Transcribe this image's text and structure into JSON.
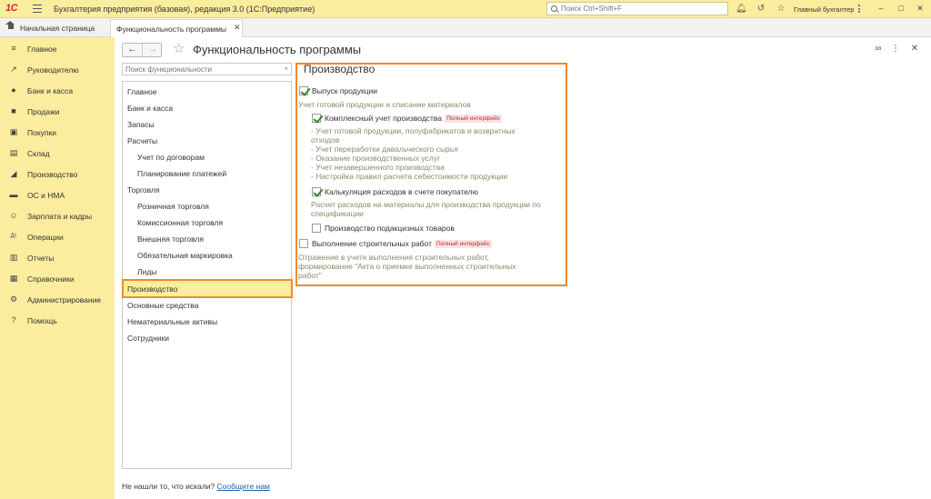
{
  "titlebar": {
    "logo": "1С",
    "app_title": "Бухгалтерия предприятия (базовая), редакция 3.0  (1С:Предприятие)",
    "search_placeholder": "Поиск Ctrl+Shift+F",
    "user": "Главный бухгалтер"
  },
  "tabs": {
    "home": "Начальная страница",
    "open": "Функциональность программы"
  },
  "sidebar": {
    "items": [
      {
        "label": "Главное",
        "icon": "menu-lines-icon"
      },
      {
        "label": "Руководителю",
        "icon": "trend-icon"
      },
      {
        "label": "Банк и касса",
        "icon": "coins-icon"
      },
      {
        "label": "Продажи",
        "icon": "bag-icon"
      },
      {
        "label": "Покупки",
        "icon": "cart-icon"
      },
      {
        "label": "Склад",
        "icon": "box-icon"
      },
      {
        "label": "Производство",
        "icon": "factory-icon"
      },
      {
        "label": "ОС и НМА",
        "icon": "truck-icon"
      },
      {
        "label": "Зарплата и кадры",
        "icon": "people-icon"
      },
      {
        "label": "Операции",
        "icon": "dt-kt-icon"
      },
      {
        "label": "Отчеты",
        "icon": "chart-icon"
      },
      {
        "label": "Справочники",
        "icon": "book-icon"
      },
      {
        "label": "Администрирование",
        "icon": "gear-icon"
      },
      {
        "label": "Помощь",
        "icon": "question-icon"
      }
    ]
  },
  "form": {
    "title": "Функциональность программы",
    "search_placeholder": "Поиск функциональности",
    "tree": [
      {
        "label": "Главное",
        "level": 0
      },
      {
        "label": "Банк и касса",
        "level": 0
      },
      {
        "label": "Запасы",
        "level": 0
      },
      {
        "label": "Расчеты",
        "level": 0
      },
      {
        "label": "Учет по договорам",
        "level": 1
      },
      {
        "label": "Планирование платежей",
        "level": 1
      },
      {
        "label": "Торговля",
        "level": 0
      },
      {
        "label": "Розничная торговля",
        "level": 1
      },
      {
        "label": "Комиссионная торговля",
        "level": 1
      },
      {
        "label": "Внешняя торговля",
        "level": 1
      },
      {
        "label": "Обязательная маркировка",
        "level": 1
      },
      {
        "label": "Лиды",
        "level": 1
      },
      {
        "label": "Производство",
        "level": 0,
        "selected": true
      },
      {
        "label": "Основные средства",
        "level": 0
      },
      {
        "label": "Нематериальные активы",
        "level": 0
      },
      {
        "label": "Сотрудники",
        "level": 0
      }
    ],
    "bottom_text": "Не нашли то, что искали?",
    "bottom_link": "Сообщите нам"
  },
  "section": {
    "title": "Производство",
    "badge": "Полный интерфейс",
    "options": {
      "release": {
        "label": "Выпуск продукции",
        "checked": true,
        "hint": "Учет готовой продукции и списание материалов"
      },
      "complex": {
        "label": "Комплексный учет производства",
        "checked": true,
        "hint_lines": [
          "- Учет готовой продукции, полуфабрикатов и возвратных",
          "отходов",
          "- Учет переработки давальческого сырья",
          "- Оказание производственных услуг",
          "- Учет незавершенного производства",
          "- Настройка правил расчета себестоимости продукции"
        ]
      },
      "calc": {
        "label": "Калькуляция расходов в счете покупателю",
        "checked": true,
        "hint_lines": [
          "Расчет расходов на материалы для производства продукции по",
          "спецификации"
        ]
      },
      "excise": {
        "label": "Производство подакцизных товаров",
        "checked": false
      },
      "construction": {
        "label": "Выполнение строительных работ",
        "checked": false,
        "hint_lines": [
          "Отражение в учете выполнения строительных работ,",
          "формирование \"Акта о приемке выполненных строительных",
          "работ\""
        ]
      }
    }
  },
  "colors": {
    "accent_yellow": "#fbed9e",
    "highlight_orange": "#f08a2b",
    "check_green": "#2f8a2f"
  }
}
